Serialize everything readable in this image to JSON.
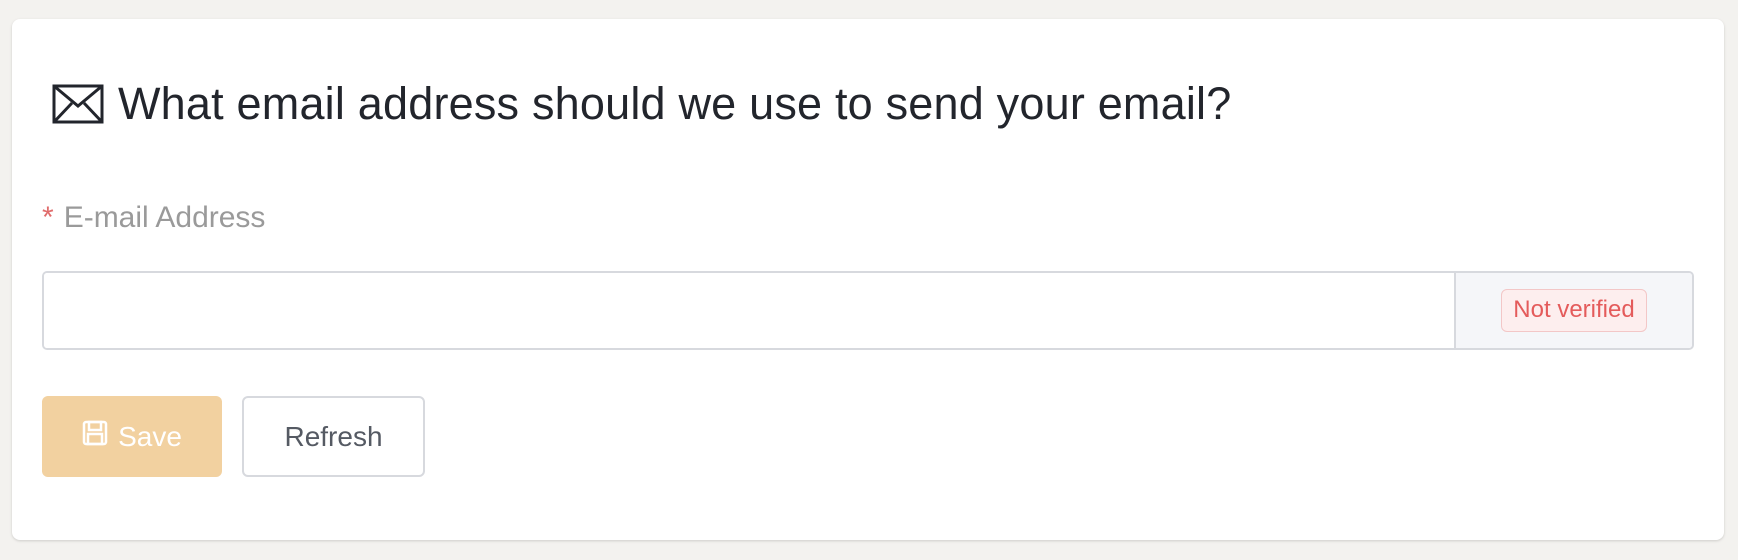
{
  "heading": {
    "icon": "envelope-icon",
    "text": "What email address should we use to send your email?"
  },
  "field": {
    "required_marker": "*",
    "label": "E-mail Address",
    "value": "",
    "placeholder": "",
    "status_badge": "Not verified"
  },
  "buttons": {
    "save": {
      "label": "Save",
      "icon": "floppy-disk-icon"
    },
    "refresh": {
      "label": "Refresh"
    }
  },
  "colors": {
    "background": "#f3f2ef",
    "card": "#ffffff",
    "heading_text": "#22252c",
    "label_text": "#9a9a9a",
    "required": "#e06c6c",
    "badge_text": "#e45b5b",
    "badge_bg": "#fdeeee",
    "save_button_bg": "#f2d1a0",
    "refresh_button_text": "#555a63"
  }
}
